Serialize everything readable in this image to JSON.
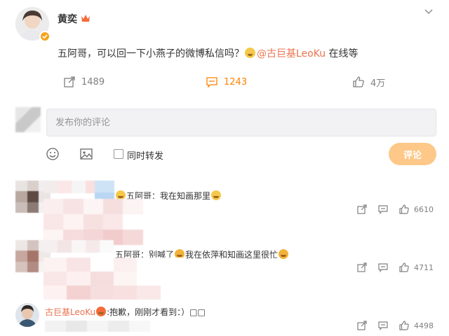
{
  "post": {
    "author": "黄奕",
    "text_before": "五阿哥，可以回一下小燕子的微博私信吗？",
    "mention": "@古巨基LeoKu",
    "text_after": " 在线等",
    "actions": {
      "repost_count": "1489",
      "comment_count": "1243",
      "like_count": "4万"
    },
    "icons": {
      "more": "chevron-down-icon",
      "repost": "share-icon",
      "comment": "comment-icon",
      "like": "thumb-up-icon",
      "badge": "verified-badge-icon"
    }
  },
  "composer": {
    "placeholder": "发布你的评论",
    "repost_label": "同时转发",
    "submit_label": "评论",
    "icons": [
      "emoji-icon",
      "image-icon"
    ]
  },
  "comments": [
    {
      "name": "",
      "text_prefix": "",
      "text": "五阿哥：我在知画那里",
      "like_count": "6610"
    },
    {
      "name": "",
      "text_prefix": "五阿哥：别喊了",
      "text": "我在依萍和知画这里很忙",
      "like_count": "4711"
    },
    {
      "name": "古巨基LeoKu",
      "text": ":抱歉，刚刚才看到：）",
      "text_tail": "□□",
      "like_count": "4498"
    }
  ],
  "colors": {
    "accent": "#ff8200",
    "mention": "#eb7350",
    "submit_button": "#fdc888",
    "composer_bg": "#f2f2f5",
    "muted_text": "#808080"
  }
}
